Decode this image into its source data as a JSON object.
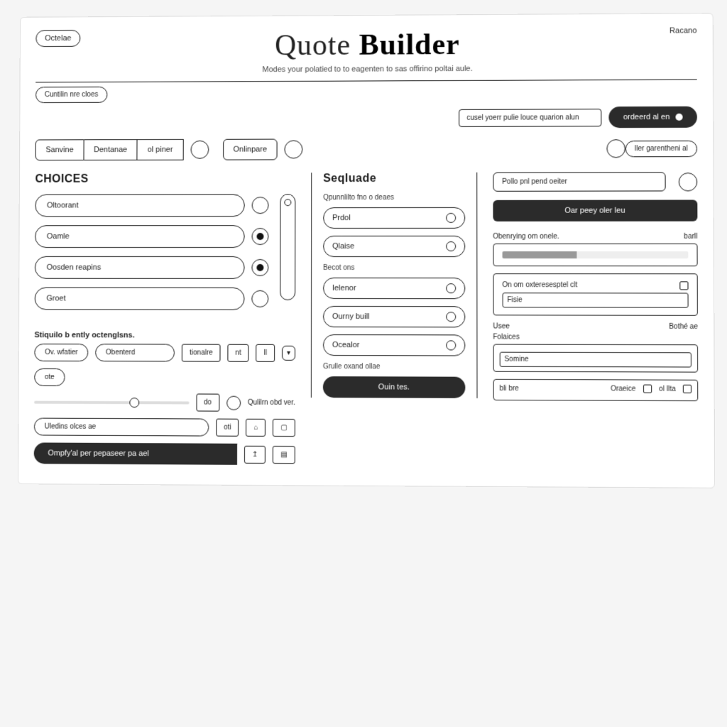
{
  "header": {
    "top_left_tag": "Octelae",
    "title_a": "Quote",
    "title_b": "Builder",
    "subtitle": "Modes your polatied to to eagenten to sas offirino poltai aule.",
    "top_right": "Racano",
    "sub_tag": "Cuntilin nre cloes"
  },
  "cta": {
    "hint_input": "cusel yoerr pulie louce quarion alun",
    "primary": "ordeerd al en"
  },
  "filters": {
    "a": "Sanvine",
    "b": "Dentanae",
    "c": "ol piner",
    "d": "Onlinpare",
    "e": "ller garentheni al"
  },
  "choices": {
    "title": "CHOICES",
    "items": [
      "Oltoorant",
      "Oamle",
      "Oosden reapins",
      "Groet"
    ],
    "sub_title": "Stiquilo b ently octenglsns.",
    "c1": "Ov. wfatier",
    "c2": "Obenterd",
    "c3": "tionalre",
    "chk": "ote",
    "sl_label": "Qulilrn obd ver.",
    "long1": "Uledins olces ae",
    "long2": "Ompfy'al per pepaseer pa ael",
    "tiny1": "do",
    "tiny2": "oti"
  },
  "mid": {
    "title": "Seqluade",
    "caption": "Qpunnlilto fno o deaes",
    "items": [
      "Prdol",
      "Qlaise",
      "Ielenor",
      "Ourny buill",
      "Ocealor"
    ],
    "sep": "Becot ons",
    "foot": "Grulle oxand ollae",
    "btn": "Ouin tes."
  },
  "right": {
    "top_pill": "Pollo pnl pend oeiter",
    "header_btn": "Oar peey oler leu",
    "sec1_title": "Obenrying om onele.",
    "sec1_small": "barll",
    "sec2_title": "On om oxteresesptel clt",
    "sec2_field": "Fisie",
    "kv1_k": "Usee",
    "kv1_v": "Bothé ae",
    "kv2_k": "Folaices",
    "field_a": "Somine",
    "field_b": "bli bre",
    "chk_a": "Oraeice",
    "chk_b": "ol llta"
  }
}
